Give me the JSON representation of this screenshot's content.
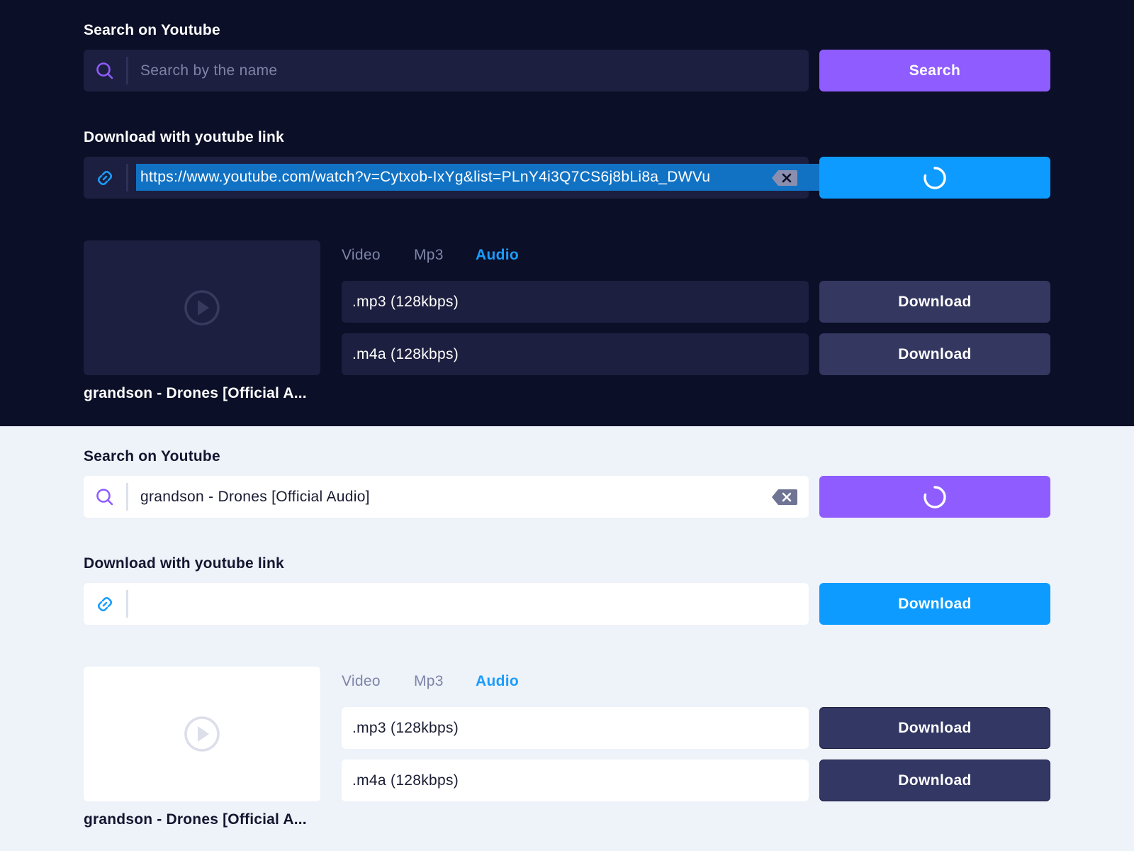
{
  "dark_panel": {
    "search_label": "Search on Youtube",
    "search_placeholder": "Search by the name",
    "search_value": "",
    "search_button_label": "Search",
    "link_label": "Download with youtube link",
    "link_value": "https://www.youtube.com/watch?v=Cytxob-IxYg&list=PLnY4i3Q7CS6j8bLi8a_DWVu",
    "link_button_state": "loading",
    "tabs": [
      "Video",
      "Mp3",
      "Audio"
    ],
    "active_tab": "Audio",
    "formats": [
      {
        "label": ".mp3 (128kbps)",
        "button": "Download"
      },
      {
        "label": ".m4a (128kbps)",
        "button": "Download"
      }
    ],
    "video_title": "grandson - Drones [Official A..."
  },
  "light_panel": {
    "search_label": "Search on Youtube",
    "search_value": "grandson - Drones [Official Audio]",
    "search_button_state": "loading",
    "link_label": "Download with youtube link",
    "link_value": "",
    "link_button_label": "Download",
    "tabs": [
      "Video",
      "Mp3",
      "Audio"
    ],
    "active_tab": "Audio",
    "formats": [
      {
        "label": ".mp3 (128kbps)",
        "button": "Download"
      },
      {
        "label": ".m4a (128kbps)",
        "button": "Download"
      }
    ],
    "video_title": "grandson - Drones [Official A..."
  },
  "icons": {
    "search": "search-icon",
    "link": "link-icon",
    "clear": "backspace-clear-icon",
    "play": "play-circle-icon",
    "spinner": "loading-spinner-icon"
  },
  "colors": {
    "dark_bg": "#0b0f27",
    "light_bg": "#eef2f9",
    "purple_accent": "#8f5cff",
    "blue_accent": "#0d9bff",
    "navy_button": "#343760",
    "active_tab": "#1a9dfc"
  }
}
